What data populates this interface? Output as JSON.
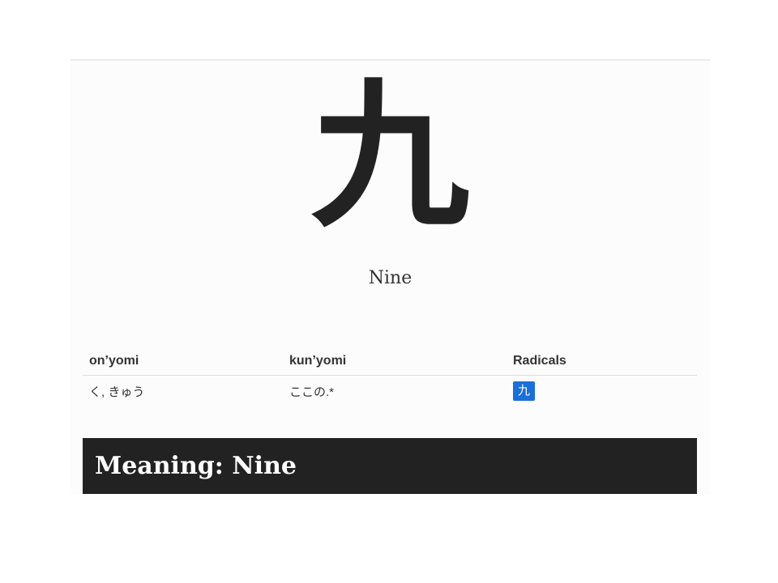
{
  "kanji": {
    "character": "九",
    "english": "Nine"
  },
  "readings": {
    "headers": {
      "onyomi": "on’yomi",
      "kunyomi": "kun’yomi",
      "radicals": "Radicals"
    },
    "onyomi_value": "く, きゅう",
    "kunyomi_value": "ここの.*",
    "radical_value": "九",
    "radical_color": "#1a6fd8"
  },
  "meaning": {
    "title": "Meaning: Nine"
  }
}
